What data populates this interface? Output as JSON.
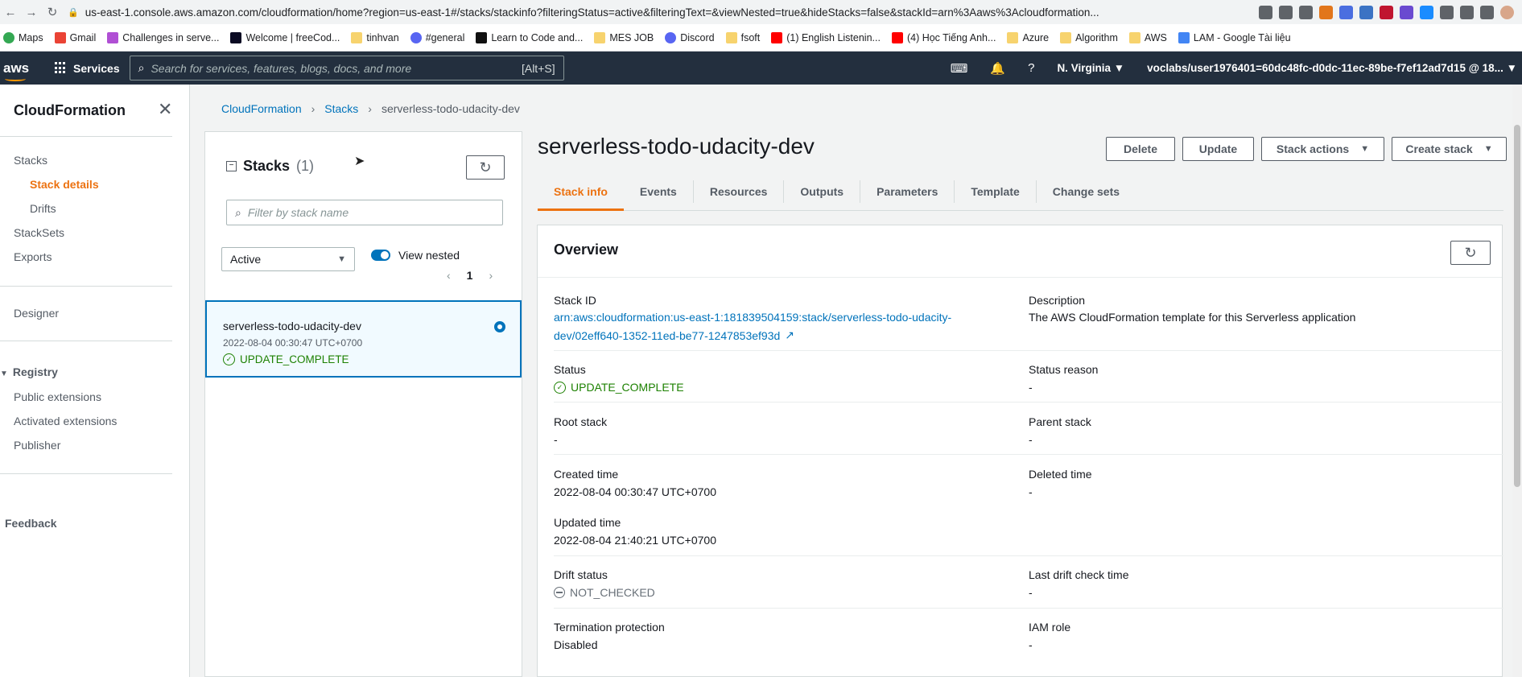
{
  "browser": {
    "url": "us-east-1.console.aws.amazon.com/cloudformation/home?region=us-east-1#/stacks/stackinfo?filteringStatus=active&filteringText=&viewNested=true&hideStacks=false&stackId=arn%3Aaws%3Acloudformation...",
    "bookmarks": [
      "Maps",
      "Gmail",
      "Challenges in serve...",
      "Welcome | freeCod...",
      "tinhvan",
      "#general",
      "Learn to Code and...",
      "MES JOB",
      "Discord",
      "fsoft",
      "(1) English Listenin...",
      "(4) Học Tiếng Anh...",
      "Azure",
      "Algorithm",
      "AWS",
      "LAM - Google Tài liệu"
    ]
  },
  "aws_nav": {
    "logo": "aws",
    "services_label": "Services",
    "search_placeholder": "Search for services, features, blogs, docs, and more",
    "search_hint": "[Alt+S]",
    "region": "N. Virginia ▼",
    "user": "voclabs/user1976401=60dc48fc-d0dc-11ec-89be-f7ef12ad7d15 @ 18... ▼"
  },
  "sidebar": {
    "title": "CloudFormation",
    "items": [
      {
        "label": "Stacks"
      },
      {
        "label": "Stack details"
      },
      {
        "label": "Drifts"
      },
      {
        "label": "StackSets"
      },
      {
        "label": "Exports"
      },
      {
        "label": "Designer"
      },
      {
        "label": "Registry"
      },
      {
        "label": "Public extensions"
      },
      {
        "label": "Activated extensions"
      },
      {
        "label": "Publisher"
      },
      {
        "label": "Feedback"
      }
    ]
  },
  "breadcrumb": [
    "CloudFormation",
    "Stacks",
    "serverless-todo-udacity-dev"
  ],
  "stacks_panel": {
    "title": "Stacks",
    "count": "(1)",
    "filter_placeholder": "Filter by stack name",
    "status_filter": "Active",
    "view_nested_label": "View nested",
    "page": "1",
    "stack": {
      "name": "serverless-todo-udacity-dev",
      "date": "2022-08-04 00:30:47 UTC+0700",
      "status": "UPDATE_COMPLETE"
    }
  },
  "detail": {
    "title": "serverless-todo-udacity-dev",
    "buttons": {
      "delete": "Delete",
      "update": "Update",
      "stack_actions": "Stack actions",
      "create_stack": "Create stack"
    },
    "tabs": [
      "Stack info",
      "Events",
      "Resources",
      "Outputs",
      "Parameters",
      "Template",
      "Change sets"
    ],
    "overview": {
      "title": "Overview",
      "stack_id_label": "Stack ID",
      "stack_id_line1": "arn:aws:cloudformation:us-east-1:181839504159:stack/serverless-todo-udacity-",
      "stack_id_line2": "dev/02eff640-1352-11ed-be77-1247853ef93d",
      "description_label": "Description",
      "description": "The AWS CloudFormation template for this Serverless application",
      "status_label": "Status",
      "status": "UPDATE_COMPLETE",
      "status_reason_label": "Status reason",
      "status_reason": "-",
      "root_stack_label": "Root stack",
      "root_stack": "-",
      "parent_stack_label": "Parent stack",
      "parent_stack": "-",
      "created_time_label": "Created time",
      "created_time": "2022-08-04 00:30:47 UTC+0700",
      "deleted_time_label": "Deleted time",
      "deleted_time": "-",
      "updated_time_label": "Updated time",
      "updated_time": "2022-08-04 21:40:21 UTC+0700",
      "drift_status_label": "Drift status",
      "drift_status": "NOT_CHECKED",
      "last_drift_label": "Last drift check time",
      "last_drift": "-",
      "termination_label": "Termination protection",
      "termination": "Disabled",
      "iam_role_label": "IAM role",
      "iam_role": "-"
    }
  },
  "colors": {
    "accent": "#ec7211",
    "link": "#0073bb",
    "success": "#1d8102",
    "nav_bg": "#232f3e"
  }
}
